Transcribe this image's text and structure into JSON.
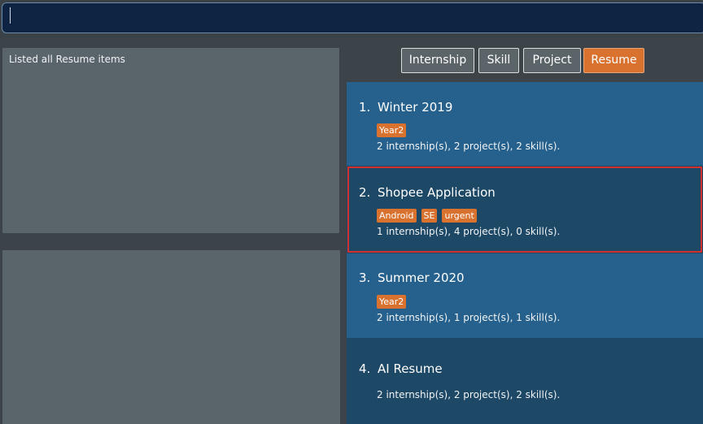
{
  "command_box": {
    "value": ""
  },
  "result_display": {
    "text": "Listed all Resume items"
  },
  "tabs": [
    {
      "label": "Internship",
      "active": false
    },
    {
      "label": "Skill",
      "active": false
    },
    {
      "label": "Project",
      "active": false
    },
    {
      "label": "Resume",
      "active": true
    }
  ],
  "resumes": [
    {
      "index": "1.",
      "title": "Winter 2019",
      "tags": [
        "Year2"
      ],
      "summary": "2 internship(s), 2 project(s), 2 skill(s).",
      "selected": false
    },
    {
      "index": "2.",
      "title": "Shopee Application",
      "tags": [
        "Android",
        "SE",
        "urgent"
      ],
      "summary": "1 internship(s), 4 project(s), 0 skill(s).",
      "selected": true
    },
    {
      "index": "3.",
      "title": "Summer 2020",
      "tags": [
        "Year2"
      ],
      "summary": "2 internship(s), 1 project(s), 1 skill(s).",
      "selected": false
    },
    {
      "index": "4.",
      "title": "AI Resume",
      "tags": [],
      "summary": "2 internship(s), 2 project(s), 2 skill(s).",
      "selected": false
    }
  ],
  "colors": {
    "command_background": "#0f2442",
    "panel_gray": "#5a646b",
    "card_light": "#26618d",
    "card_dark": "#1d4866",
    "accent_orange": "#d9722f",
    "selection_border": "#d32f2f"
  }
}
